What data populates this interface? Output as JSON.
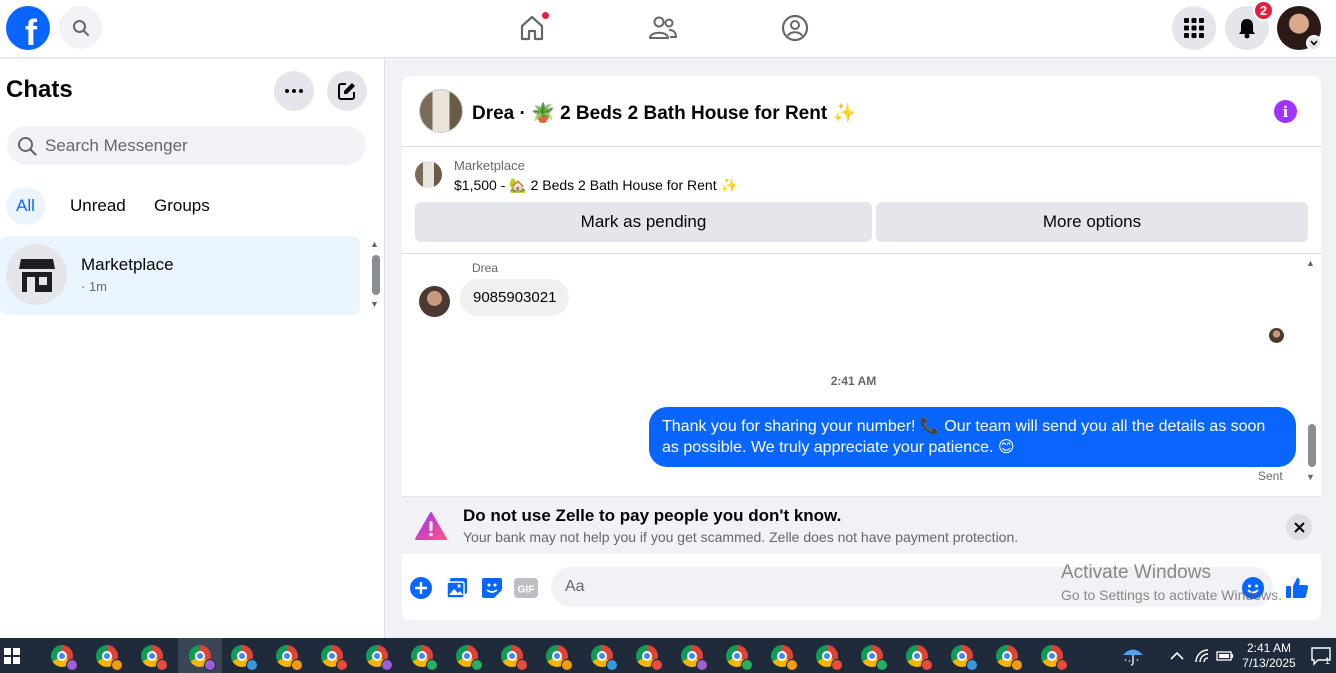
{
  "topbar": {
    "logo_letter": "f",
    "notifications_count": "2"
  },
  "sidebar": {
    "title": "Chats",
    "search_placeholder": "Search Messenger",
    "filters": [
      "All",
      "Unread",
      "Groups"
    ],
    "active_filter": "All",
    "chats": [
      {
        "name": "Marketplace",
        "time": "· 1m"
      }
    ]
  },
  "conversation": {
    "title": "Drea · 🪴 2 Beds 2 Bath House for Rent ✨",
    "marketplace_label": "Marketplace",
    "listing": "$1,500 - 🏡 2 Beds 2 Bath House for Rent ✨",
    "mark_pending_label": "Mark as pending",
    "more_options_label": "More options",
    "messages": [
      {
        "sender": "Drea",
        "text": "9085903021",
        "direction": "in"
      },
      {
        "timestamp": "2:41 AM"
      },
      {
        "sender": "me",
        "text": "Thank you for sharing your number! 📞 Our team will send you all the details as soon as possible. We truly appreciate your patience. 😊",
        "direction": "out",
        "status": "Sent"
      }
    ],
    "warning": {
      "title": "Do not use Zelle to pay people you don't know.",
      "body": "Your bank may not help you if you get scammed. Zelle does not have payment protection."
    },
    "composer_placeholder": "Aa",
    "gif_label": "GIF"
  },
  "watermark": {
    "line1": "Activate Windows",
    "line2": "Go to Settings to activate Windows."
  },
  "taskbar": {
    "time": "2:41 AM",
    "date": "7/13/2025",
    "notification_count": "1",
    "app_count": 23
  },
  "colors": {
    "brand": "#0866ff",
    "badge": "#e41e3f",
    "info": "#a033ff",
    "active_filter_bg": "#ebf5ff"
  }
}
